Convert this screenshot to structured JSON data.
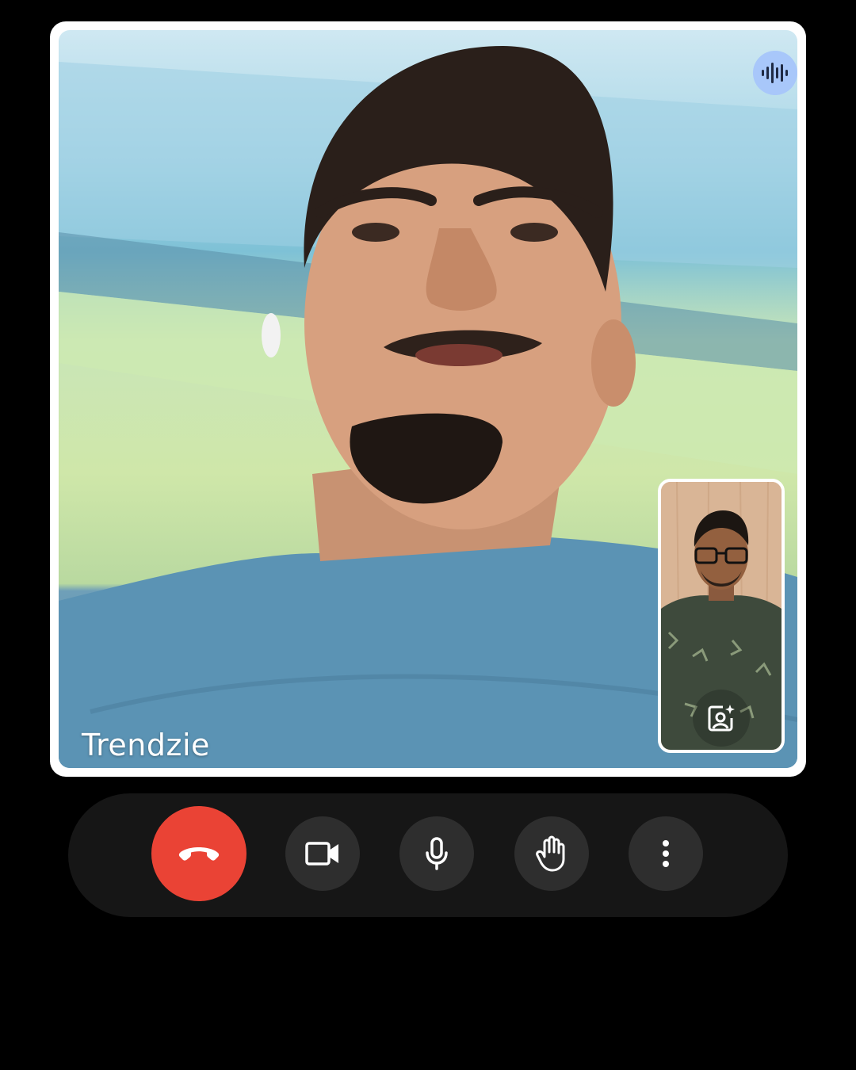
{
  "call": {
    "participant_name": "Trendzie",
    "speaking_indicator_icon": "audio-waveform-icon",
    "accent_color": "#a8c7fa"
  },
  "self_view": {
    "effects_icon": "visual-effects-icon"
  },
  "controls": {
    "end_call": {
      "icon": "call-end-icon",
      "color": "#ea4335"
    },
    "camera": {
      "icon": "videocam-icon"
    },
    "microphone": {
      "icon": "mic-icon"
    },
    "raise_hand": {
      "icon": "hand-icon"
    },
    "more": {
      "icon": "more-vert-icon"
    }
  }
}
